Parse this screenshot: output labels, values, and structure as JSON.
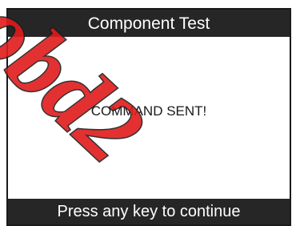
{
  "screen": {
    "title": "Component Test",
    "message": "COMMAND SENT!",
    "footer_prompt": "Press any key to continue"
  },
  "watermark": {
    "text": "obd2"
  },
  "colors": {
    "bar_background": "#262626",
    "bar_text": "#ffffff",
    "content_background": "#ffffff",
    "message_text": "#1a1a1a"
  }
}
